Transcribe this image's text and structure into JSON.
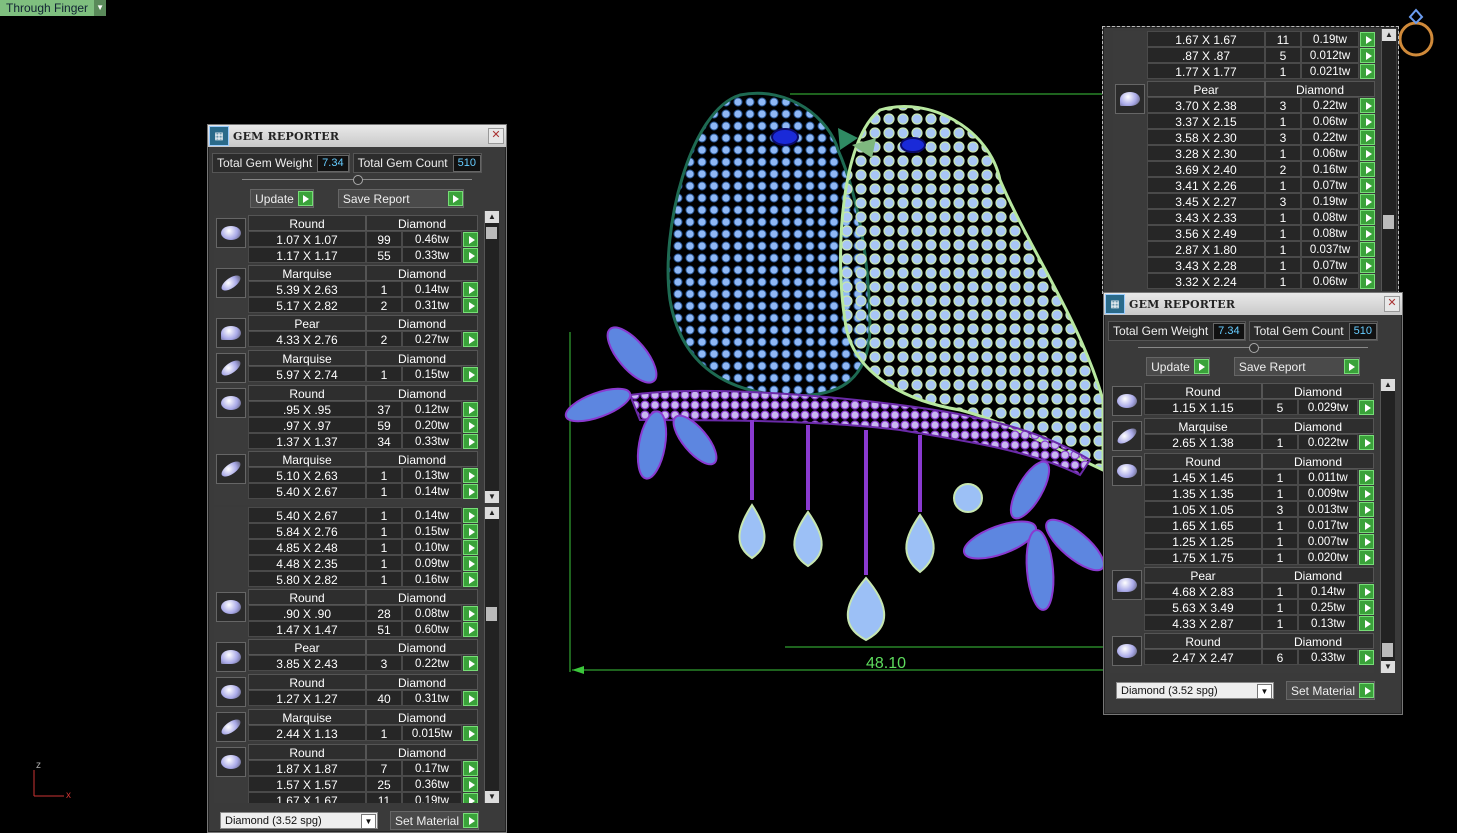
{
  "view_mode": {
    "label": "Through Finger"
  },
  "dimension_label": "48.10",
  "axes": {
    "z": "z",
    "x": "x"
  },
  "left_panel": {
    "title": "GEM REPORTER",
    "total_weight_label": "Total Gem Weight",
    "total_weight": "7.34",
    "total_count_label": "Total Gem Count",
    "total_count": "510",
    "update_label": "Update",
    "save_label": "Save Report",
    "material_select": "Diamond     (3.52 spg)",
    "set_material_label": "Set Material",
    "list_top": [
      {
        "shape": "Round",
        "material": "Diamond",
        "icon": "round",
        "rows": [
          [
            "1.07 X 1.07",
            "99",
            "0.46tw"
          ],
          [
            "1.17 X 1.17",
            "55",
            "0.33tw"
          ]
        ]
      },
      {
        "shape": "Marquise",
        "material": "Diamond",
        "icon": "marquise",
        "rows": [
          [
            "5.39 X 2.63",
            "1",
            "0.14tw"
          ],
          [
            "5.17 X 2.82",
            "2",
            "0.31tw"
          ]
        ]
      },
      {
        "shape": "Pear",
        "material": "Diamond",
        "icon": "pear",
        "rows": [
          [
            "4.33 X 2.76",
            "2",
            "0.27tw"
          ]
        ]
      },
      {
        "shape": "Marquise",
        "material": "Diamond",
        "icon": "marquise",
        "rows": [
          [
            "5.97 X 2.74",
            "1",
            "0.15tw"
          ]
        ]
      },
      {
        "shape": "Round",
        "material": "Diamond",
        "icon": "round",
        "rows": [
          [
            ".95 X .95",
            "37",
            "0.12tw"
          ],
          [
            ".97 X .97",
            "59",
            "0.20tw"
          ],
          [
            "1.37 X 1.37",
            "34",
            "0.33tw"
          ]
        ]
      },
      {
        "shape": "Marquise",
        "material": "Diamond",
        "icon": "marquise",
        "rows": [
          [
            "5.10 X 2.63",
            "1",
            "0.13tw"
          ],
          [
            "5.40 X 2.67",
            "1",
            "0.14tw"
          ]
        ]
      }
    ],
    "list_bottom": [
      {
        "shape": "",
        "material": "",
        "icon": "",
        "rows": [
          [
            "5.40 X 2.67",
            "1",
            "0.14tw"
          ],
          [
            "5.84 X 2.76",
            "1",
            "0.15tw"
          ],
          [
            "4.85 X 2.48",
            "1",
            "0.10tw"
          ],
          [
            "4.48 X 2.35",
            "1",
            "0.09tw"
          ],
          [
            "5.80 X 2.82",
            "1",
            "0.16tw"
          ]
        ]
      },
      {
        "shape": "Round",
        "material": "Diamond",
        "icon": "round",
        "rows": [
          [
            ".90 X .90",
            "28",
            "0.08tw"
          ],
          [
            "1.47 X 1.47",
            "51",
            "0.60tw"
          ]
        ]
      },
      {
        "shape": "Pear",
        "material": "Diamond",
        "icon": "pear",
        "rows": [
          [
            "3.85 X 2.43",
            "3",
            "0.22tw"
          ]
        ]
      },
      {
        "shape": "Round",
        "material": "Diamond",
        "icon": "round",
        "rows": [
          [
            "1.27 X 1.27",
            "40",
            "0.31tw"
          ]
        ]
      },
      {
        "shape": "Marquise",
        "material": "Diamond",
        "icon": "marquise",
        "rows": [
          [
            "2.44 X 1.13",
            "1",
            "0.015tw"
          ]
        ]
      },
      {
        "shape": "Round",
        "material": "Diamond",
        "icon": "round",
        "rows": [
          [
            "1.87 X 1.87",
            "7",
            "0.17tw"
          ],
          [
            "1.57 X 1.57",
            "25",
            "0.36tw"
          ],
          [
            "1.67 X 1.67",
            "11",
            "0.19tw"
          ]
        ]
      }
    ]
  },
  "right_top_list": [
    {
      "shape": "",
      "material": "",
      "icon": "",
      "rows": [
        [
          "1.67 X 1.67",
          "11",
          "0.19tw"
        ],
        [
          ".87 X .87",
          "5",
          "0.012tw"
        ],
        [
          "1.77 X 1.77",
          "1",
          "0.021tw"
        ]
      ]
    },
    {
      "shape": "Pear",
      "material": "Diamond",
      "icon": "pear",
      "rows": [
        [
          "3.70 X 2.38",
          "3",
          "0.22tw"
        ],
        [
          "3.37 X 2.15",
          "1",
          "0.06tw"
        ],
        [
          "3.58 X 2.30",
          "3",
          "0.22tw"
        ],
        [
          "3.28 X 2.30",
          "1",
          "0.06tw"
        ],
        [
          "3.69 X 2.40",
          "2",
          "0.16tw"
        ],
        [
          "3.41 X 2.26",
          "1",
          "0.07tw"
        ],
        [
          "3.45 X 2.27",
          "3",
          "0.19tw"
        ],
        [
          "3.43 X 2.33",
          "1",
          "0.08tw"
        ],
        [
          "3.56 X 2.49",
          "1",
          "0.08tw"
        ],
        [
          "2.87 X 1.80",
          "1",
          "0.037tw"
        ],
        [
          "3.43 X 2.28",
          "1",
          "0.07tw"
        ],
        [
          "3.32 X 2.24",
          "1",
          "0.06tw"
        ]
      ]
    }
  ],
  "right_panel": {
    "title": "GEM REPORTER",
    "total_weight_label": "Total Gem Weight",
    "total_weight": "7.34",
    "total_count_label": "Total Gem Count",
    "total_count": "510",
    "update_label": "Update",
    "save_label": "Save Report",
    "material_select": "Diamond     (3.52 spg)",
    "set_material_label": "Set Material",
    "list": [
      {
        "shape": "Round",
        "material": "Diamond",
        "icon": "round",
        "rows": [
          [
            "1.15 X 1.15",
            "5",
            "0.029tw"
          ]
        ]
      },
      {
        "shape": "Marquise",
        "material": "Diamond",
        "icon": "marquise",
        "rows": [
          [
            "2.65 X 1.38",
            "1",
            "0.022tw"
          ]
        ]
      },
      {
        "shape": "Round",
        "material": "Diamond",
        "icon": "round",
        "rows": [
          [
            "1.45 X 1.45",
            "1",
            "0.011tw"
          ],
          [
            "1.35 X 1.35",
            "1",
            "0.009tw"
          ],
          [
            "1.05 X 1.05",
            "3",
            "0.013tw"
          ],
          [
            "1.65 X 1.65",
            "1",
            "0.017tw"
          ],
          [
            "1.25 X 1.25",
            "1",
            "0.007tw"
          ],
          [
            "1.75 X 1.75",
            "1",
            "0.020tw"
          ]
        ]
      },
      {
        "shape": "Pear",
        "material": "Diamond",
        "icon": "pear",
        "rows": [
          [
            "4.68 X 2.83",
            "1",
            "0.14tw"
          ],
          [
            "5.63 X 3.49",
            "1",
            "0.25tw"
          ],
          [
            "4.33 X 2.87",
            "1",
            "0.13tw"
          ]
        ]
      },
      {
        "shape": "Round",
        "material": "Diamond",
        "icon": "round",
        "rows": [
          [
            "2.47 X 2.47",
            "6",
            "0.33tw"
          ]
        ]
      }
    ]
  },
  "colors": {
    "accent_green": "#3aa23a",
    "dimension_green": "#5ddc5d",
    "gem_blue": "#7ea9f0",
    "metal_green": "#2f8a63",
    "purple": "#8a3ad0"
  }
}
